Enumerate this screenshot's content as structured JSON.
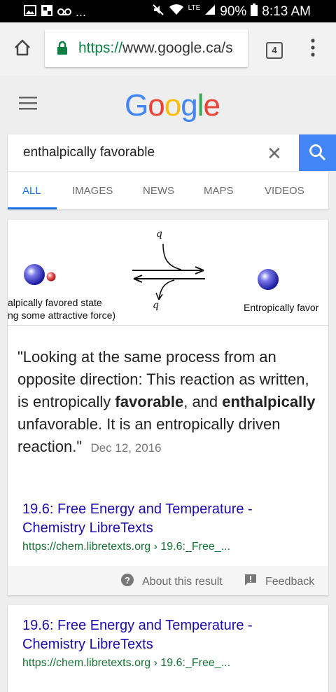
{
  "status_bar": {
    "battery": "90%",
    "time": "8:13 AM",
    "network": "LTE",
    "more": "..."
  },
  "browser": {
    "url_scheme": "https://",
    "url_host": "www.google.ca/s",
    "tab_count": "4"
  },
  "google": {
    "logo_letters": [
      "G",
      "o",
      "o",
      "g",
      "l",
      "e"
    ],
    "logo_colors": [
      "#4285F4",
      "#EA4335",
      "#FBBC05",
      "#4285F4",
      "#34A853",
      "#EA4335"
    ]
  },
  "search": {
    "query": "enthalpically favorable"
  },
  "tabs": [
    {
      "label": "ALL",
      "active": true
    },
    {
      "label": "IMAGES",
      "active": false
    },
    {
      "label": "NEWS",
      "active": false
    },
    {
      "label": "MAPS",
      "active": false
    },
    {
      "label": "VIDEOS",
      "active": false
    }
  ],
  "featured": {
    "diagram": {
      "q_top": "q",
      "q_bottom": "q",
      "left_label_1": "alpically favored state",
      "left_label_2": "ng some attractive force)",
      "right_label": "Entropically favor"
    },
    "quote": {
      "p1": "\"Looking at the same process from an opposite direction: This reaction as written, is entropically ",
      "b1": "favorable",
      "p2": ", and ",
      "b2": "enthalpically",
      "p3": " unfavorable. It is an entropically driven reaction.\"",
      "date": "Dec 12, 2016"
    },
    "result_title": "19.6: Free Energy and Temperature - Chemistry LibreTexts",
    "result_url": "https://chem.libretexts.org › 19.6:_Free_...",
    "about": "About this result",
    "feedback": "Feedback"
  },
  "second_result": {
    "title": "19.6: Free Energy and Temperature - Chemistry LibreTexts",
    "url": "https://chem.libretexts.org › 19.6:_Free_..."
  }
}
